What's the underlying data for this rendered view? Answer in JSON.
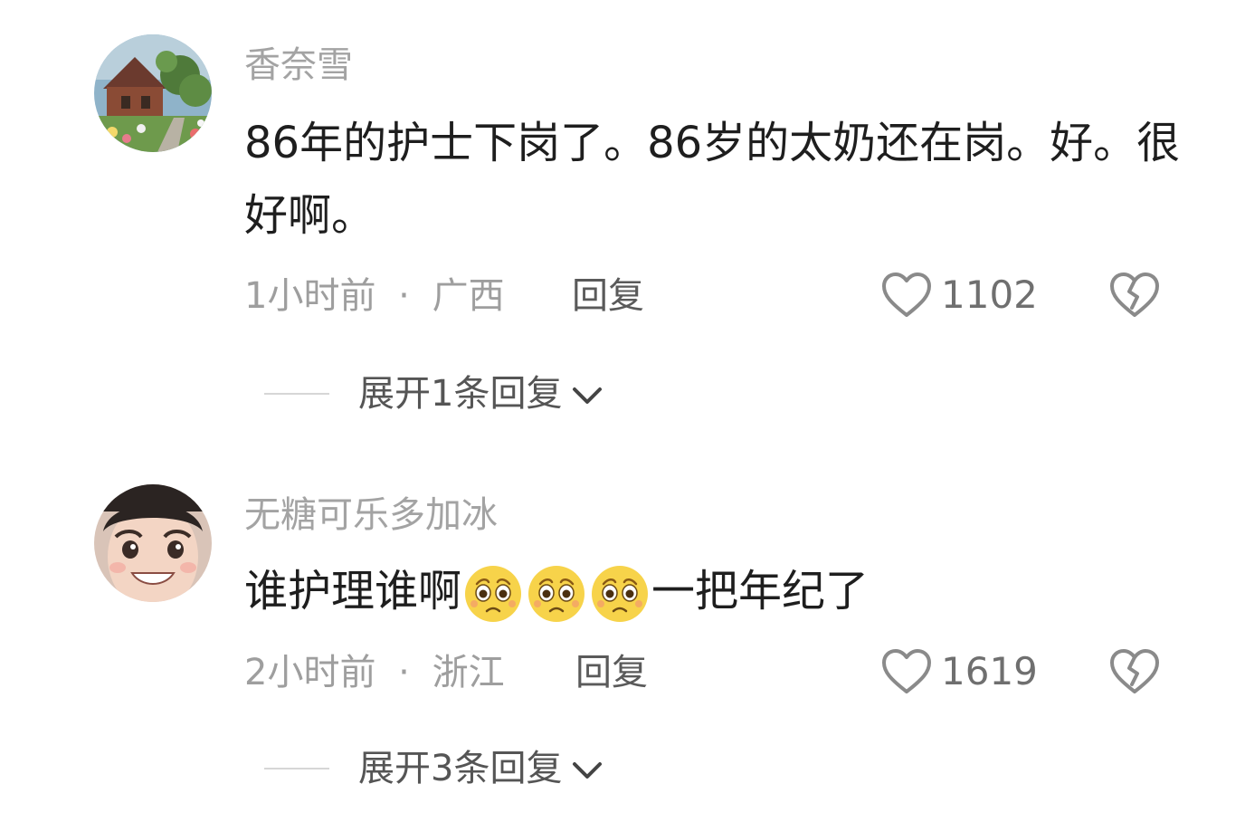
{
  "comments": [
    {
      "username": "香奈雪",
      "content": "86年的护士下岗了。86岁的太奶还在岗。好。很好啊。",
      "time": "1小时前",
      "separator": "·",
      "location": "广西",
      "reply_label": "回复",
      "like_count": "1102",
      "expand_label": "展开1条回复",
      "avatar": "garden-cottage-photo"
    },
    {
      "username": "无糖可乐多加冰",
      "content_before": "谁护理谁啊",
      "emojis": [
        "pleading-face-emoji",
        "pleading-face-emoji",
        "pleading-face-emoji"
      ],
      "content_after": "一把年纪了",
      "time": "2小时前",
      "separator": "·",
      "location": "浙江",
      "reply_label": "回复",
      "like_count": "1619",
      "expand_label": "展开3条回复",
      "avatar": "smiling-boy-illustration"
    }
  ],
  "icons": {
    "like": "heart-outline-icon",
    "dislike": "broken-heart-icon",
    "expand": "chevron-down-icon"
  },
  "colors": {
    "username": "#a3a3a3",
    "meta": "#9e9e9e",
    "content": "#1e1e1e",
    "background": "#ffffff"
  }
}
